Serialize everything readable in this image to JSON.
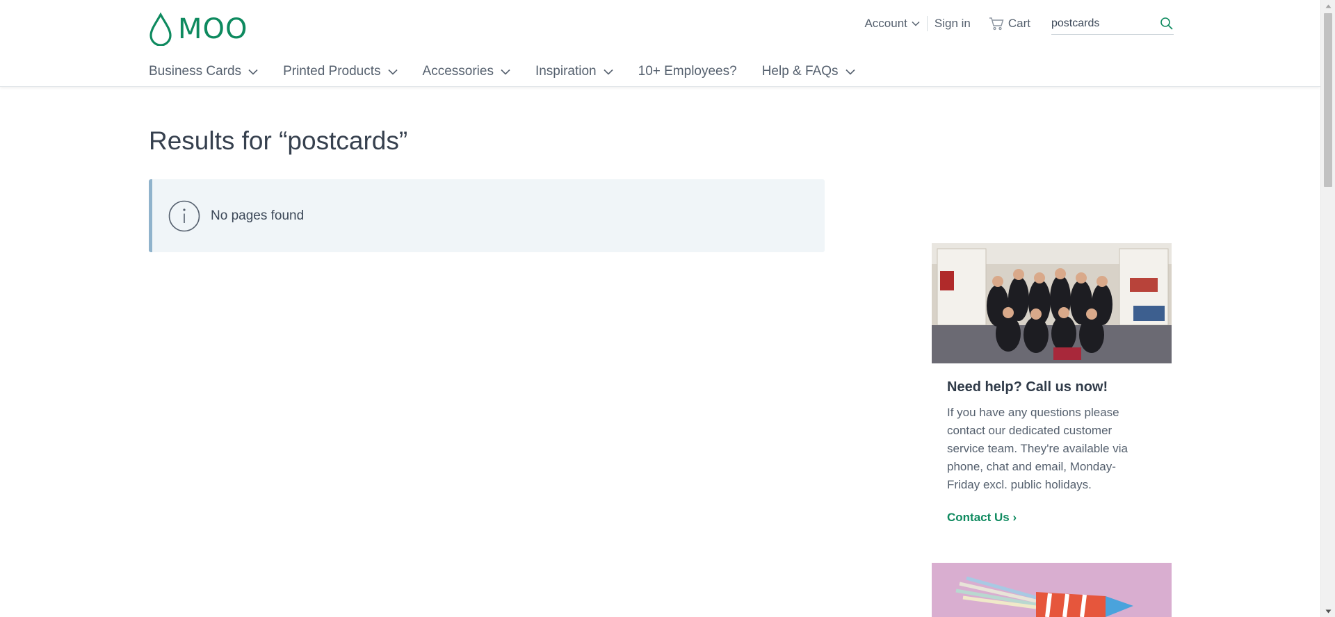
{
  "header": {
    "logo_text": "MOO",
    "account_label": "Account",
    "signin_label": "Sign in",
    "cart_label": "Cart",
    "search_value": "postcards"
  },
  "nav": {
    "items": [
      {
        "label": "Business Cards"
      },
      {
        "label": "Printed Products"
      },
      {
        "label": "Accessories"
      },
      {
        "label": "Inspiration"
      },
      {
        "label": "10+ Employees?"
      },
      {
        "label": "Help & FAQs"
      }
    ]
  },
  "main": {
    "results_title": "Results for “postcards”",
    "no_results_message": "No pages found"
  },
  "sidebar": {
    "help_title": "Need help? Call us now!",
    "help_text": "If you have any questions please contact our dedicated customer service team. They're available via phone, chat and email, Monday-Friday excl. public holidays.",
    "contact_link": "Contact Us ›"
  },
  "colors": {
    "brand_green": "#0e8a5f",
    "notice_bg": "#f0f5f8",
    "notice_border": "#90b3cc"
  },
  "icons": [
    "moo-drop-logo-icon",
    "chevron-down-icon",
    "cart-icon",
    "search-icon",
    "info-icon"
  ]
}
